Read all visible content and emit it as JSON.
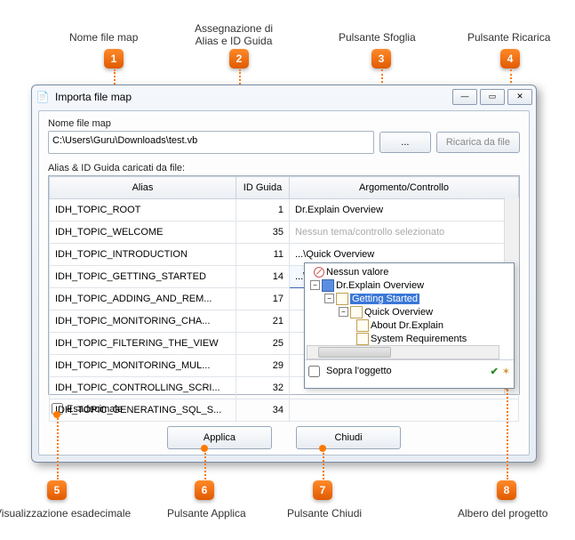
{
  "callouts": {
    "c1": "Nome file map",
    "c2": "Assegnazione di\nAlias e ID Guida",
    "c3": "Pulsante Sfoglia",
    "c4": "Pulsante Ricarica",
    "c5": "Visualizzazione esadecimale",
    "c6": "Pulsante Applica",
    "c7": "Pulsante Chiudi",
    "c8": "Albero del progetto",
    "n1": "1",
    "n2": "2",
    "n3": "3",
    "n4": "4",
    "n5": "5",
    "n6": "6",
    "n7": "7",
    "n8": "8"
  },
  "window": {
    "title": "Importa file map"
  },
  "fields": {
    "filemap_label": "Nome file map",
    "filemap_value": "C:\\Users\\Guru\\Downloads\\test.vb",
    "browse_label": "...",
    "reload_label": "Ricarica da file",
    "loaded_label": "Alias & ID Guida caricati da file:",
    "hex_label": "Esadecimale"
  },
  "table": {
    "headers": {
      "alias": "Alias",
      "id": "ID Guida",
      "topic": "Argomento/Controllo"
    },
    "rows": [
      {
        "alias": "IDH_TOPIC_ROOT",
        "id": "1",
        "topic": "Dr.Explain Overview"
      },
      {
        "alias": "IDH_TOPIC_WELCOME",
        "id": "35",
        "topic": "Nessun tema/controllo selezionato",
        "muted": true
      },
      {
        "alias": "IDH_TOPIC_INTRODUCTION",
        "id": "11",
        "topic": "...\\Quick Overview"
      },
      {
        "alias": "IDH_TOPIC_GETTING_STARTED",
        "id": "14",
        "topic": "...\\Getting Started",
        "hl": true
      },
      {
        "alias": "IDH_TOPIC_ADDING_AND_REM...",
        "id": "17",
        "topic": ""
      },
      {
        "alias": "IDH_TOPIC_MONITORING_CHA...",
        "id": "21",
        "topic": ""
      },
      {
        "alias": "IDH_TOPIC_FILTERING_THE_VIEW",
        "id": "25",
        "topic": ""
      },
      {
        "alias": "IDH_TOPIC_MONITORING_MUL...",
        "id": "29",
        "topic": ""
      },
      {
        "alias": "IDH_TOPIC_CONTROLLING_SCRI...",
        "id": "32",
        "topic": ""
      },
      {
        "alias": "IDH_TOPIC_GENERATING_SQL_S...",
        "id": "34",
        "topic": ""
      }
    ]
  },
  "tree": {
    "none": "Nessun valore",
    "root": "Dr.Explain Overview",
    "n1": "Getting Started",
    "n2": "Quick Overview",
    "n3": "About Dr.Explain",
    "n4": "System Requirements",
    "footer_label": "Sopra l'oggetto"
  },
  "buttons": {
    "apply": "Applica",
    "close": "Chiudi"
  }
}
